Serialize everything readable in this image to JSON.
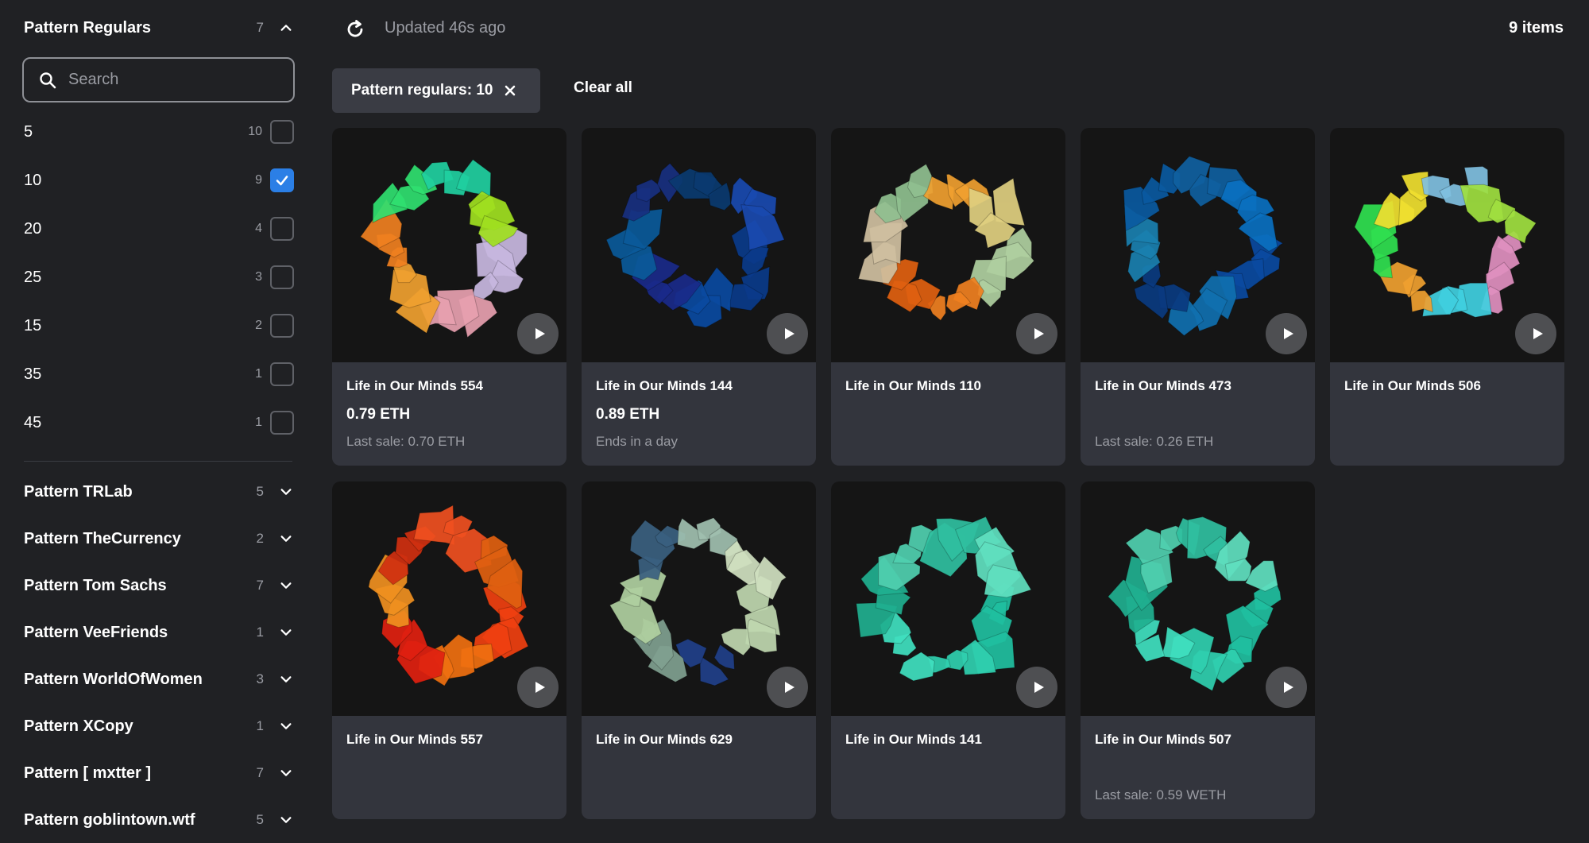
{
  "sidebar": {
    "regulars": {
      "title": "Pattern Regulars",
      "count": "7"
    },
    "search": {
      "placeholder": "Search",
      "value": ""
    },
    "options": [
      {
        "value": "5",
        "count": "10",
        "checked": false
      },
      {
        "value": "10",
        "count": "9",
        "checked": true
      },
      {
        "value": "20",
        "count": "4",
        "checked": false
      },
      {
        "value": "25",
        "count": "3",
        "checked": false
      },
      {
        "value": "15",
        "count": "2",
        "checked": false
      },
      {
        "value": "35",
        "count": "1",
        "checked": false
      },
      {
        "value": "45",
        "count": "1",
        "checked": false
      }
    ],
    "groups": [
      {
        "title": "Pattern TRLab",
        "count": "5"
      },
      {
        "title": "Pattern TheCurrency",
        "count": "2"
      },
      {
        "title": "Pattern Tom Sachs",
        "count": "7"
      },
      {
        "title": "Pattern VeeFriends",
        "count": "1"
      },
      {
        "title": "Pattern WorldOfWomen",
        "count": "3"
      },
      {
        "title": "Pattern XCopy",
        "count": "1"
      },
      {
        "title": "Pattern [ mxtter ]",
        "count": "7"
      },
      {
        "title": "Pattern goblintown.wtf",
        "count": "5"
      }
    ]
  },
  "topbar": {
    "updated": "Updated 46s ago",
    "items": "9 items",
    "chip": "Pattern regulars: 10",
    "clear_all": "Clear all"
  },
  "cards": [
    {
      "name": "Life in Our Minds 554",
      "price": "0.79 ETH",
      "sub": "Last sale: 0.70 ETH",
      "palette": [
        "#c8b8e0",
        "#e8a0b0",
        "#f0a030",
        "#f08020",
        "#30e070",
        "#20d0a0",
        "#a0e020"
      ]
    },
    {
      "name": "Life in Our Minds 144",
      "price": "0.89 ETH",
      "sub": "Ends in a day",
      "palette": [
        "#0a3a8a",
        "#0a4aa0",
        "#1a2a8a",
        "#0a5a9a",
        "#183080",
        "#0a3a70",
        "#1a4ab0"
      ]
    },
    {
      "name": "Life in Our Minds 110",
      "price": "",
      "sub": "",
      "palette": [
        "#b0d0a0",
        "#f08020",
        "#e06010",
        "#d0c0a0",
        "#90c090",
        "#f0a030",
        "#e0d080"
      ]
    },
    {
      "name": "Life in Our Minds 473",
      "price": "",
      "sub": "Last sale: 0.26 ETH",
      "palette": [
        "#0a4aa0",
        "#1070b0",
        "#0a3a80",
        "#1a80b0",
        "#0a5aa0",
        "#1060a0",
        "#0a70c0"
      ]
    },
    {
      "name": "Life in Our Minds 506",
      "price": "",
      "sub": "",
      "palette": [
        "#e090c0",
        "#40d0e0",
        "#f0a030",
        "#30e050",
        "#f0e030",
        "#80c0e0",
        "#a0e040"
      ]
    },
    {
      "name": "Life in Our Minds 557",
      "price": "",
      "sub": "",
      "palette": [
        "#f04010",
        "#f07010",
        "#e02010",
        "#f09020",
        "#d03010",
        "#f05020",
        "#e06010"
      ]
    },
    {
      "name": "Life in Our Minds 629",
      "price": "",
      "sub": "",
      "palette": [
        "#c0d8b0",
        "#20408a",
        "#80a090",
        "#b0d0a0",
        "#3a6080",
        "#a0c0b0",
        "#d0e0c0"
      ]
    },
    {
      "name": "Life in Our Minds 141",
      "price": "",
      "sub": "",
      "palette": [
        "#20c0a0",
        "#30d0b0",
        "#40e0c0",
        "#20b090",
        "#50d0b0",
        "#30c0a0",
        "#60e0c0"
      ]
    },
    {
      "name": "Life in Our Minds 507",
      "price": "",
      "sub": "Last sale: 0.59 WETH",
      "palette": [
        "#20c0a0",
        "#30d0b0",
        "#40e0c0",
        "#20b090",
        "#50d0b0",
        "#30c0a0",
        "#60e0c0"
      ]
    }
  ]
}
